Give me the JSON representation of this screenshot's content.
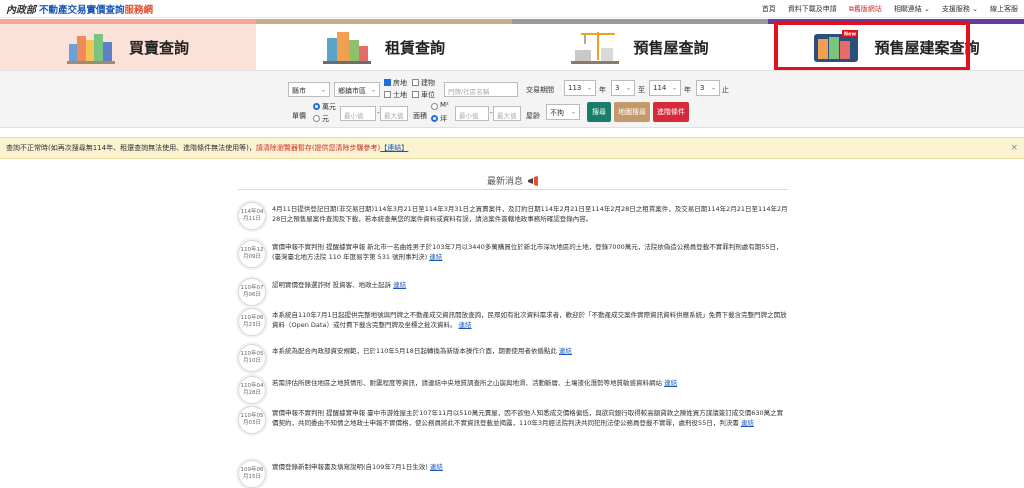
{
  "header": {
    "logo_moi": "內政部",
    "site_title": "不動產交易實價查詢",
    "site_title_suffix": "服務網",
    "nav": [
      "首頁",
      "資料下載及申請",
      "舊版網站",
      "相關連結 ⌄",
      "支援服務 ⌄",
      "線上客服"
    ]
  },
  "tabs": [
    {
      "label": "買賣查詢"
    },
    {
      "label": "租賃查詢"
    },
    {
      "label": "預售屋查詢"
    },
    {
      "label": "預售屋建案查詢",
      "badge": "New"
    }
  ],
  "search": {
    "city": "縣市",
    "district": "鄉鎮市區",
    "types": [
      "房地",
      "建物",
      "土地",
      "車位"
    ],
    "address_placeholder": "門牌/社區名稱",
    "period_label": "交易期間",
    "from_year": "113",
    "from_year_unit": "年",
    "from_month": "3",
    "to_label": "至",
    "to_year": "114",
    "to_year_unit": "年",
    "to_month": "3",
    "to_month_unit": "止",
    "price_label": "單價",
    "unit_wan": "萬元",
    "unit_yuan": "元",
    "min_placeholder": "最小值",
    "max_placeholder": "最大值",
    "dash": "-",
    "area_label": "面積",
    "unit_m2": "M²",
    "unit_ping": "坪",
    "age_label": "屋齡",
    "age_value": "不拘",
    "search_btn": "搜尋",
    "map_btn": "地圖搜尋",
    "advanced_btn": "進階條件"
  },
  "notice": {
    "text1": "查詢不正常時(如再次搜尋無114年、租還查詢無法使用、進階條件無法使用等)，",
    "text2": "請清除瀏覽器暫存",
    "text3": "(提供您清除步驟參考)",
    "link": "【連結】",
    "close": "×"
  },
  "news": {
    "title": "最新消息",
    "items": [
      {
        "y": "114年04",
        "d": "月11日",
        "text": "4月11日提供登記日期(非交易日期)114年3月21日至114年3月31日之買賣案件，及訂約日期114年2月21日至114年2月28日之租賃案件，及交易日期114年2月21日至114年2月28日之預售屋案件查詢及下載，若本統查無您的案件資料或資料有誤，請洽案件簽轄地政事務所確認登錄內容。",
        "link": ""
      },
      {
        "y": "110年12",
        "d": "月09日",
        "text": "實價申報不實判刑 提醒據實申報 新北市一名曲姓男子於103年7月以3440多萬購買位於新北市深坑地區的土地，登錄7000萬元，法院依偽造公務員登載不實罪判刑處有期55日，(臺灣臺北地方法院 110 年度易字第 531 號刑事判決)",
        "link": "連結"
      },
      {
        "y": "110年07",
        "d": "月06日",
        "text": "認明實價登錄選詐財 投資客、地政士起訴",
        "link": "連結"
      },
      {
        "y": "110年06",
        "d": "月23日",
        "text": "本系統自110年7月1日起提供完整地號與門牌之不動產成交資訊開放查詢，民眾如有批次資料需求者，歡迎於「不動產成交案件實際資訊資料供應系統」免費下載含完整門牌之開放資料（Open Data）或付費下載含完整門牌及坐標之批次資料。",
        "link": "連結"
      },
      {
        "y": "110年05",
        "d": "月10日",
        "text": "本系統為配合內政部資安規範，已於110年5月18日起轉換為新版本操作介面，期要使用者依循點此",
        "link": "連結"
      },
      {
        "y": "110年04",
        "d": "月28日",
        "text": "若需評估所居住地區之地質情形、耐震程度等資訊，請連結中央地質調查所之山崩與地滑、活動斷層、土壤液化潛勢等地質敏感資料網站",
        "link": "連結"
      },
      {
        "y": "110年05",
        "d": "月03日",
        "text": "實價申報不實判刑 提醒據實申報 臺中市游姓屋主於107年11月以510萬元賣屋，因不欲他人知悉成交價格偏低，與欲向銀行取得較高額貸款之陳姓買方謀議簽訂成交價630萬之實價契約，共同委由不知情之地政士申報不實價格，使公務員將此不實資訊登載並揭露，110年3月經法院判決共同犯刑法使公務員登載不實罪，處刑役55日，判決書",
        "link": "連結"
      },
      {
        "y": "109年06",
        "d": "月15日",
        "text": "實價登錄新制申報書及填寫說明(自109年7月1日生效)",
        "link": "連結"
      }
    ]
  },
  "colors": {
    "brand_blue": "#1a56b8",
    "accent_red": "#e2502f",
    "highlight_box": "#e0111a",
    "search_btn": "#1a7d6a",
    "map_btn": "#c39a6b",
    "advanced_btn": "#d42a3b"
  }
}
